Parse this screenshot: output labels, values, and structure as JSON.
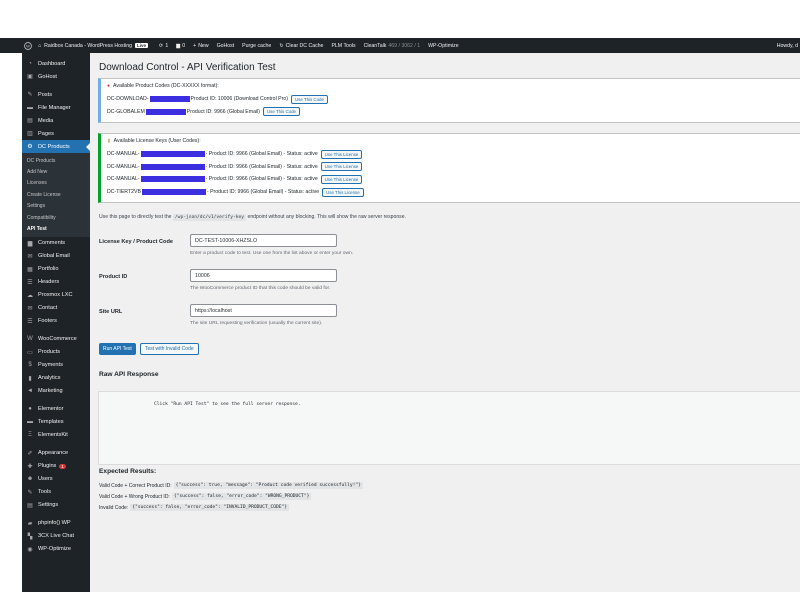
{
  "adminbar": {
    "site_name": "Raidbox Canada - WordPress Hosting",
    "live_badge": "Live",
    "updates_count": "1",
    "comments_count": "0",
    "new_label": "New",
    "gohost_label": "GoHost",
    "purge_cache": "Purge cache",
    "clear_dc_cache": "Clear DC Cache",
    "plm_tools": "PLM Tools",
    "cleantalk": "CleanTalk",
    "cleantalk_count": "469 / 3062 / 1",
    "wp_optimize": "WP-Optimize",
    "howdy": "Howdy, d"
  },
  "sidebar": {
    "items": [
      {
        "label": "Dashboard",
        "icon": "dashboard-icon"
      },
      {
        "label": "GoHost",
        "icon": "gohost-icon"
      },
      {
        "label": "Posts",
        "icon": "pin-icon"
      },
      {
        "label": "File Manager",
        "icon": "folder-icon"
      },
      {
        "label": "Media",
        "icon": "media-icon"
      },
      {
        "label": "Pages",
        "icon": "pages-icon"
      },
      {
        "label": "DC Products",
        "icon": "settings-icon"
      }
    ],
    "submenu": [
      "DC Products",
      "Add New",
      "Licenses",
      "Create License",
      "Settings",
      "Compatibility",
      "API Test"
    ],
    "items2": [
      {
        "label": "Comments",
        "icon": "comment-icon"
      },
      {
        "label": "Global Email",
        "icon": "email-icon"
      },
      {
        "label": "Portfolio",
        "icon": "portfolio-icon"
      },
      {
        "label": "Headers",
        "icon": "headers-icon"
      },
      {
        "label": "Proxmox LXC",
        "icon": "cloud-icon"
      },
      {
        "label": "Contact",
        "icon": "contact-icon"
      },
      {
        "label": "Footers",
        "icon": "footers-icon"
      }
    ],
    "items3": [
      {
        "label": "WooCommerce",
        "icon": "woo-icon"
      },
      {
        "label": "Products",
        "icon": "products-icon"
      },
      {
        "label": "Payments",
        "icon": "payments-icon"
      },
      {
        "label": "Analytics",
        "icon": "analytics-icon"
      },
      {
        "label": "Marketing",
        "icon": "marketing-icon"
      }
    ],
    "items4": [
      {
        "label": "Elementor",
        "icon": "elementor-icon"
      },
      {
        "label": "Templates",
        "icon": "templates-icon"
      },
      {
        "label": "ElementsKit",
        "icon": "elementskit-icon"
      }
    ],
    "items5": [
      {
        "label": "Appearance",
        "icon": "brush-icon"
      },
      {
        "label": "Plugins",
        "icon": "plugin-icon",
        "badge": "1"
      },
      {
        "label": "Users",
        "icon": "users-icon"
      },
      {
        "label": "Tools",
        "icon": "tools-icon"
      },
      {
        "label": "Settings",
        "icon": "settings-sliders-icon"
      }
    ],
    "items6": [
      {
        "label": "phpinfo() WP",
        "icon": "php-icon"
      },
      {
        "label": "3CX Live Chat",
        "icon": "chat-icon"
      },
      {
        "label": "WP-Optimize",
        "icon": "optimize-icon"
      }
    ]
  },
  "page": {
    "title": "Download Control - API Verification Test",
    "product_codes_heading": "Available Product Codes (DC-XXXXX format):",
    "product_codes": [
      {
        "prefix": "DC-DOWNLOAD-",
        "info": "Product ID: 10006 (Download Control Pro)",
        "button": "Use This Code"
      },
      {
        "prefix": "DC-GLOBALEM",
        "info": "Product ID: 9966 (Global Email)",
        "button": "Use This Code"
      }
    ],
    "license_heading": "Available License Keys (User Codes):",
    "license_keys": [
      {
        "prefix": "DC-MANUAL-",
        "info": "- Product ID: 9966 (Global Email) - Status: active",
        "button": "Use This License"
      },
      {
        "prefix": "DC-MANUAL-",
        "info": "- Product ID: 9966 (Global Email) - Status: active",
        "button": "Use This License"
      },
      {
        "prefix": "DC-MANUAL-",
        "info": "- Product ID: 9966 (Global Email) - Status: active",
        "button": "Use This License"
      },
      {
        "prefix": "DC-TIERT2VB",
        "info": "- Product ID: 9966 (Global Email) - Status: active",
        "button": "Use This License"
      }
    ],
    "desc_before": "Use this page to directly test the",
    "desc_code": "/wp-json/dc/v1/verify-key",
    "desc_after": "endpoint without any blocking. This will show the raw server response.",
    "form": {
      "license_label": "License Key / Product Code",
      "license_value": "DC-TEST-10006-XHZSLO",
      "license_desc": "Enter a product code to test. Use one from the list above or enter your own.",
      "product_label": "Product ID",
      "product_value": "10006",
      "product_desc": "The WooCommerce product ID that this code should be valid for.",
      "site_label": "Site URL",
      "site_value": "https://localhost",
      "site_desc": "The site URL requesting verification (usually the current site)."
    },
    "run_button": "Run API Test",
    "invalid_button": "Test with Invalid Code",
    "raw_heading": "Raw API Response",
    "raw_placeholder": "Click \"Run API Test\" to see the full server response.",
    "expected_heading": "Expected Results:",
    "expected": [
      {
        "label": "Valid Code + Correct Product ID:",
        "code": "{\"success\": true, \"message\": \"Product code verified successfully!\"}"
      },
      {
        "label": "Valid Code + Wrong Product ID:",
        "code": "{\"success\": false, \"error_code\": \"WRONG_PRODUCT\"}"
      },
      {
        "label": "Invalid Code:",
        "code": "{\"success\": false, \"error_code\": \"INVALID_PRODUCT_CODE\"}"
      }
    ]
  },
  "colors": {
    "admin_dark": "#1d2327",
    "accent_blue": "#2271b1",
    "redaction": "#3b2fe0",
    "success_green": "#00a32a"
  }
}
